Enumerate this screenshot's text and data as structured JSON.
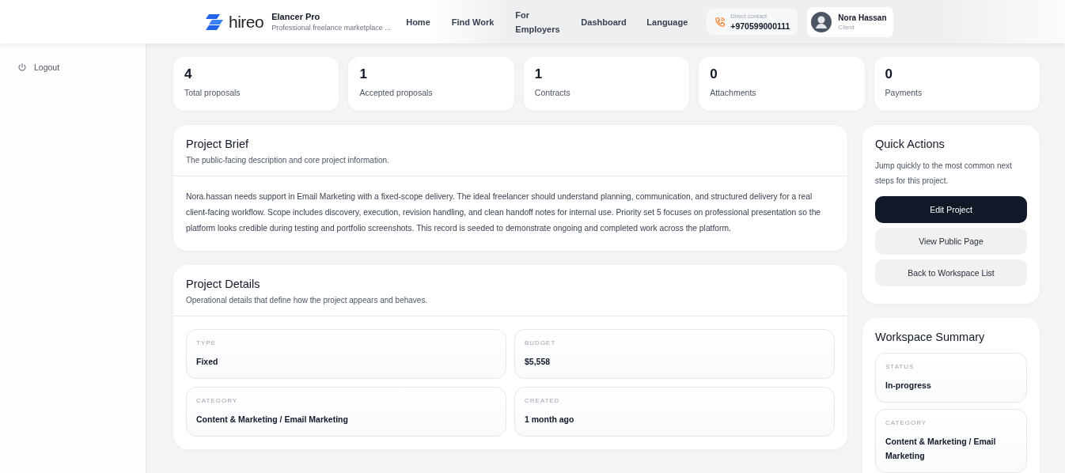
{
  "header": {
    "logo": "hireo",
    "brand": "Elancer Pro",
    "tagline": "Professional freelance marketplace ...",
    "nav": [
      "Home",
      "Find Work",
      "For Employers",
      "Dashboard",
      "Language"
    ],
    "contact": {
      "label": "Direct contact",
      "phone": "+970599000111"
    },
    "user": {
      "name": "Nora Hassan",
      "role": "Client"
    }
  },
  "sidebar": {
    "items": [
      {
        "label": "Logout",
        "kind": "logout"
      }
    ]
  },
  "stats": [
    {
      "value": "4",
      "label": "Total proposals"
    },
    {
      "value": "1",
      "label": "Accepted proposals"
    },
    {
      "value": "1",
      "label": "Contracts"
    },
    {
      "value": "0",
      "label": "Attachments"
    },
    {
      "value": "0",
      "label": "Payments"
    }
  ],
  "project_brief": {
    "title": "Project Brief",
    "subtitle": "The public-facing description and core project information.",
    "body": "Nora.hassan needs support in Email Marketing with a fixed-scope delivery. The ideal freelancer should understand planning, communication, and structured delivery for a real client-facing workflow. Scope includes discovery, execution, revision handling, and clean handoff notes for internal use. Priority set 5 focuses on professional presentation so the platform looks credible during testing and portfolio screenshots. This record is seeded to demonstrate ongoing and completed work across the platform."
  },
  "project_details": {
    "title": "Project Details",
    "subtitle": "Operational details that define how the project appears and behaves.",
    "fields": [
      {
        "label": "TYPE",
        "value": "Fixed"
      },
      {
        "label": "BUDGET",
        "value": "$5,558"
      },
      {
        "label": "CATEGORY",
        "value": "Content & Marketing / Email Marketing"
      },
      {
        "label": "CREATED",
        "value": "1 month ago"
      }
    ]
  },
  "quick_actions": {
    "title": "Quick Actions",
    "subtitle": "Jump quickly to the most common next steps for this project.",
    "buttons": [
      {
        "label": "Edit Project",
        "kind": "primary"
      },
      {
        "label": "View Public Page",
        "kind": "secondary"
      },
      {
        "label": "Back to Workspace List",
        "kind": "secondary"
      }
    ]
  },
  "workspace_summary": {
    "title": "Workspace Summary",
    "fields": [
      {
        "label": "STATUS",
        "value": "In-progress"
      },
      {
        "label": "CATEGORY",
        "value": "Content & Marketing / Email Marketing"
      }
    ]
  }
}
